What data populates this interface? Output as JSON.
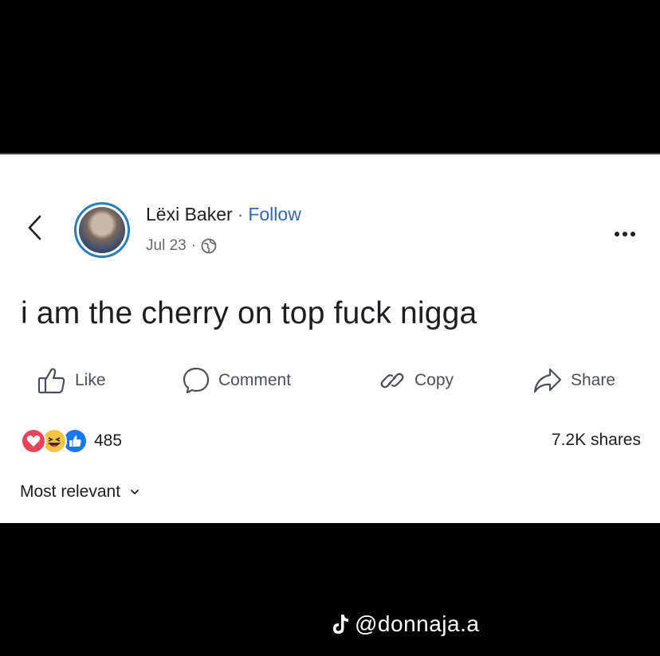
{
  "post": {
    "author_name": "Lëxi Baker",
    "separator": "·",
    "follow_label": "Follow",
    "date": "Jul 23",
    "date_separator": "·",
    "privacy_icon": "globe-icon",
    "text": "i am the cherry on top fuck nigga"
  },
  "actions": {
    "like_label": "Like",
    "comment_label": "Comment",
    "copy_label": "Copy",
    "share_label": "Share"
  },
  "stats": {
    "reaction_icons": [
      "love-reaction-icon",
      "haha-reaction-icon",
      "like-reaction-icon"
    ],
    "reaction_count": "485",
    "shares_text": "7.2K shares"
  },
  "comments": {
    "sort_label": "Most relevant"
  },
  "watermark": {
    "handle": "@donnaja.a",
    "icon": "tiktok-icon"
  },
  "colors": {
    "link": "#2d6bb5",
    "avatar_ring": "#2a7fb8",
    "love": "#e8435a",
    "haha": "#f7c343",
    "like": "#1877f2"
  }
}
